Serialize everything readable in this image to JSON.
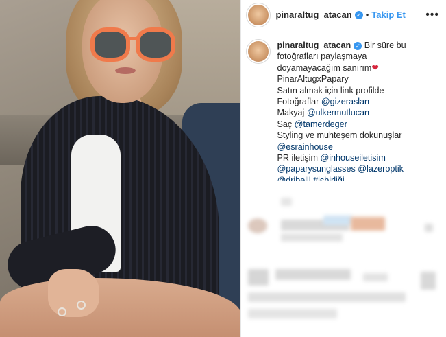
{
  "header": {
    "username": "pinaraltug_atacan",
    "follow_label": "Takip Et",
    "more_label": "•••"
  },
  "caption": {
    "username": "pinaraltug_atacan",
    "line1": "Bir süre bu",
    "line2": "fotoğrafları paylaşmaya",
    "line3": "doyamayacağım sanırım",
    "line4": "PinarAltugxPapary",
    "line5": "Satın almak için link profilde",
    "line6_prefix": "Fotoğraflar ",
    "line6_mention": "@gizeraslan",
    "line7_prefix": "Makyaj ",
    "line7_mention": "@ulkermutlucan",
    "line8_prefix": "Saç ",
    "line8_mention": "@tamerdeger",
    "line9": "Styling ve muhteşem dokunuşlar",
    "line10_mention": "@esrainhouse",
    "line11_prefix": "PR iletişim ",
    "line11_mention": "@inhouseiletisim",
    "line12_mention_a": "@paparysunglasses",
    "line12_mention_b": "@lazeroptik",
    "line13_partial": "@dribelll #işbirliği"
  },
  "colors": {
    "link": "#00376b",
    "follow": "#3897f0",
    "verified": "#3897f0",
    "heart": "#d7263d"
  },
  "icons": {
    "verified": "verified-badge-icon",
    "heart": "heart-icon",
    "more": "more-options-icon"
  }
}
